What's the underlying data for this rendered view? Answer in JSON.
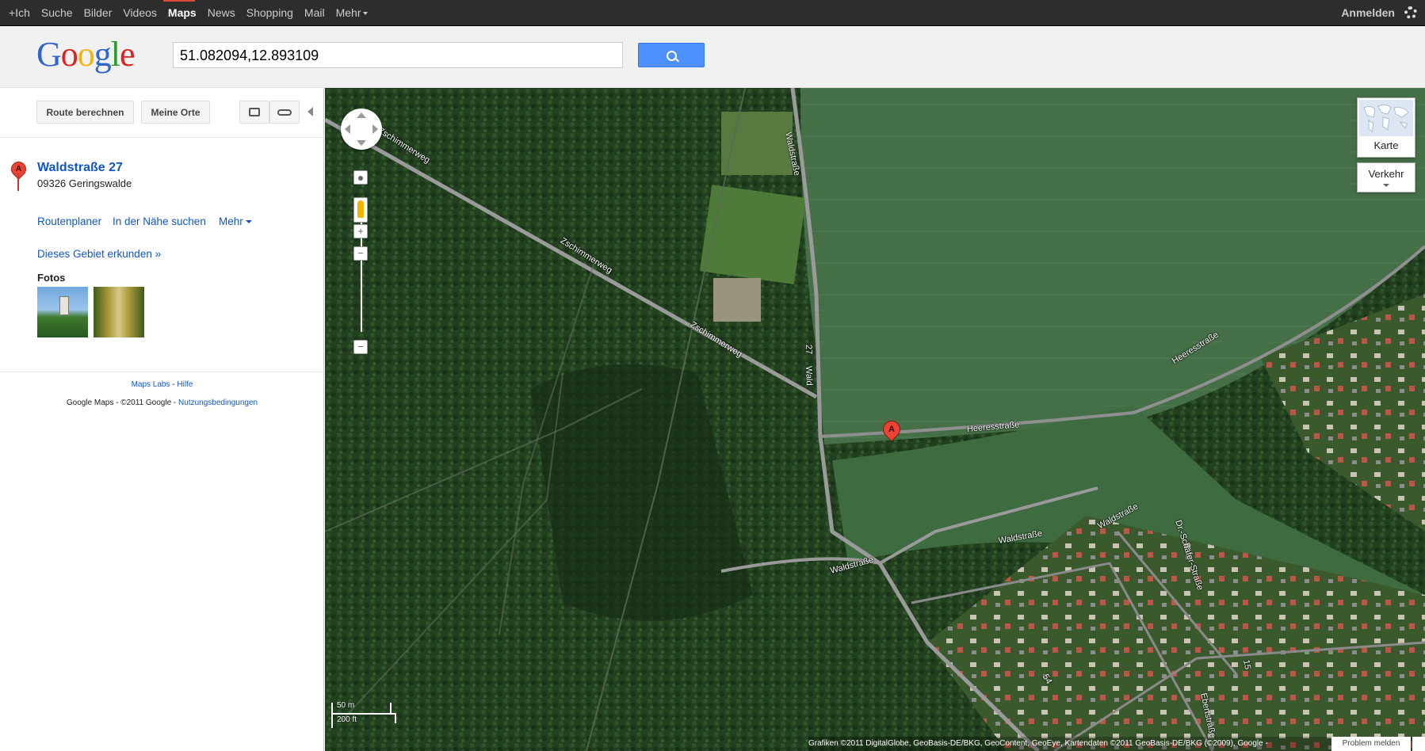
{
  "topbar": {
    "items": [
      {
        "label": "+Ich"
      },
      {
        "label": "Suche"
      },
      {
        "label": "Bilder"
      },
      {
        "label": "Videos"
      },
      {
        "label": "Maps",
        "active": true
      },
      {
        "label": "News"
      },
      {
        "label": "Shopping"
      },
      {
        "label": "Mail"
      },
      {
        "label": "Mehr"
      }
    ],
    "signin": "Anmelden",
    "accent_color": "#dd4b39",
    "settings_icon": "gear-icon"
  },
  "header": {
    "logo": [
      "G",
      "o",
      "o",
      "g",
      "l",
      "e"
    ],
    "search_value": "51.082094,12.893109",
    "search_button_icon": "search-icon"
  },
  "panel": {
    "route_button": "Route berechnen",
    "places_button": "Meine Orte",
    "print_icon": "print-icon",
    "link_icon": "link-icon",
    "marker_letter": "A",
    "place_name": "Waldstraße 27",
    "place_address": "09326 Geringswalde",
    "actions": {
      "route": "Routenplaner",
      "nearby": "In der Nähe suchen",
      "more": "Mehr"
    },
    "explore": "Dieses Gebiet erkunden »",
    "photos_title": "Fotos",
    "footer": {
      "labs": "Maps Labs",
      "sep": " - ",
      "help": "Hilfe",
      "copyright": "Google Maps - ©2011 Google - ",
      "terms": "Nutzungsbedingungen"
    }
  },
  "map": {
    "labels": {
      "zschimmer1": "Zschimmerweg",
      "zschimmer2": "Zschimmerweg",
      "zschimmer3": "Zschimmerweg",
      "waldstrasse_top": "Waldstraße",
      "waldstrasse_mid": "Wald",
      "heeres1": "Heeresstraße",
      "heeres2": "Heeresstraße",
      "waldstrasse_se1": "Waldstraße",
      "waldstrasse_se2": "Waldstraße",
      "waldstrasse_sw": "Waldstraße",
      "schaefer": "Dr.-Schäfer-Straße",
      "ebert": "Ebertstraße",
      "num27": "27",
      "num15": "15",
      "num54": "54"
    },
    "marker_letter": "A",
    "layer_buttons": {
      "karte": "Karte",
      "verkehr": "Verkehr"
    },
    "zoom_plus": "+",
    "zoom_minus": "−",
    "scale": {
      "metric": "50 m",
      "imperial": "200 ft"
    },
    "attribution": "Grafiken ©2011 DigitalGlobe, GeoBasis-DE/BKG, GeoContent, GeoEye, Kartendaten ©2011 GeoBasis-DE/BKG (©2009), Google -",
    "report_problem": "Problem melden",
    "colors": {
      "forest": "#1f3a1c",
      "field": "#3f6f41",
      "road": "#9a9a9a"
    }
  }
}
